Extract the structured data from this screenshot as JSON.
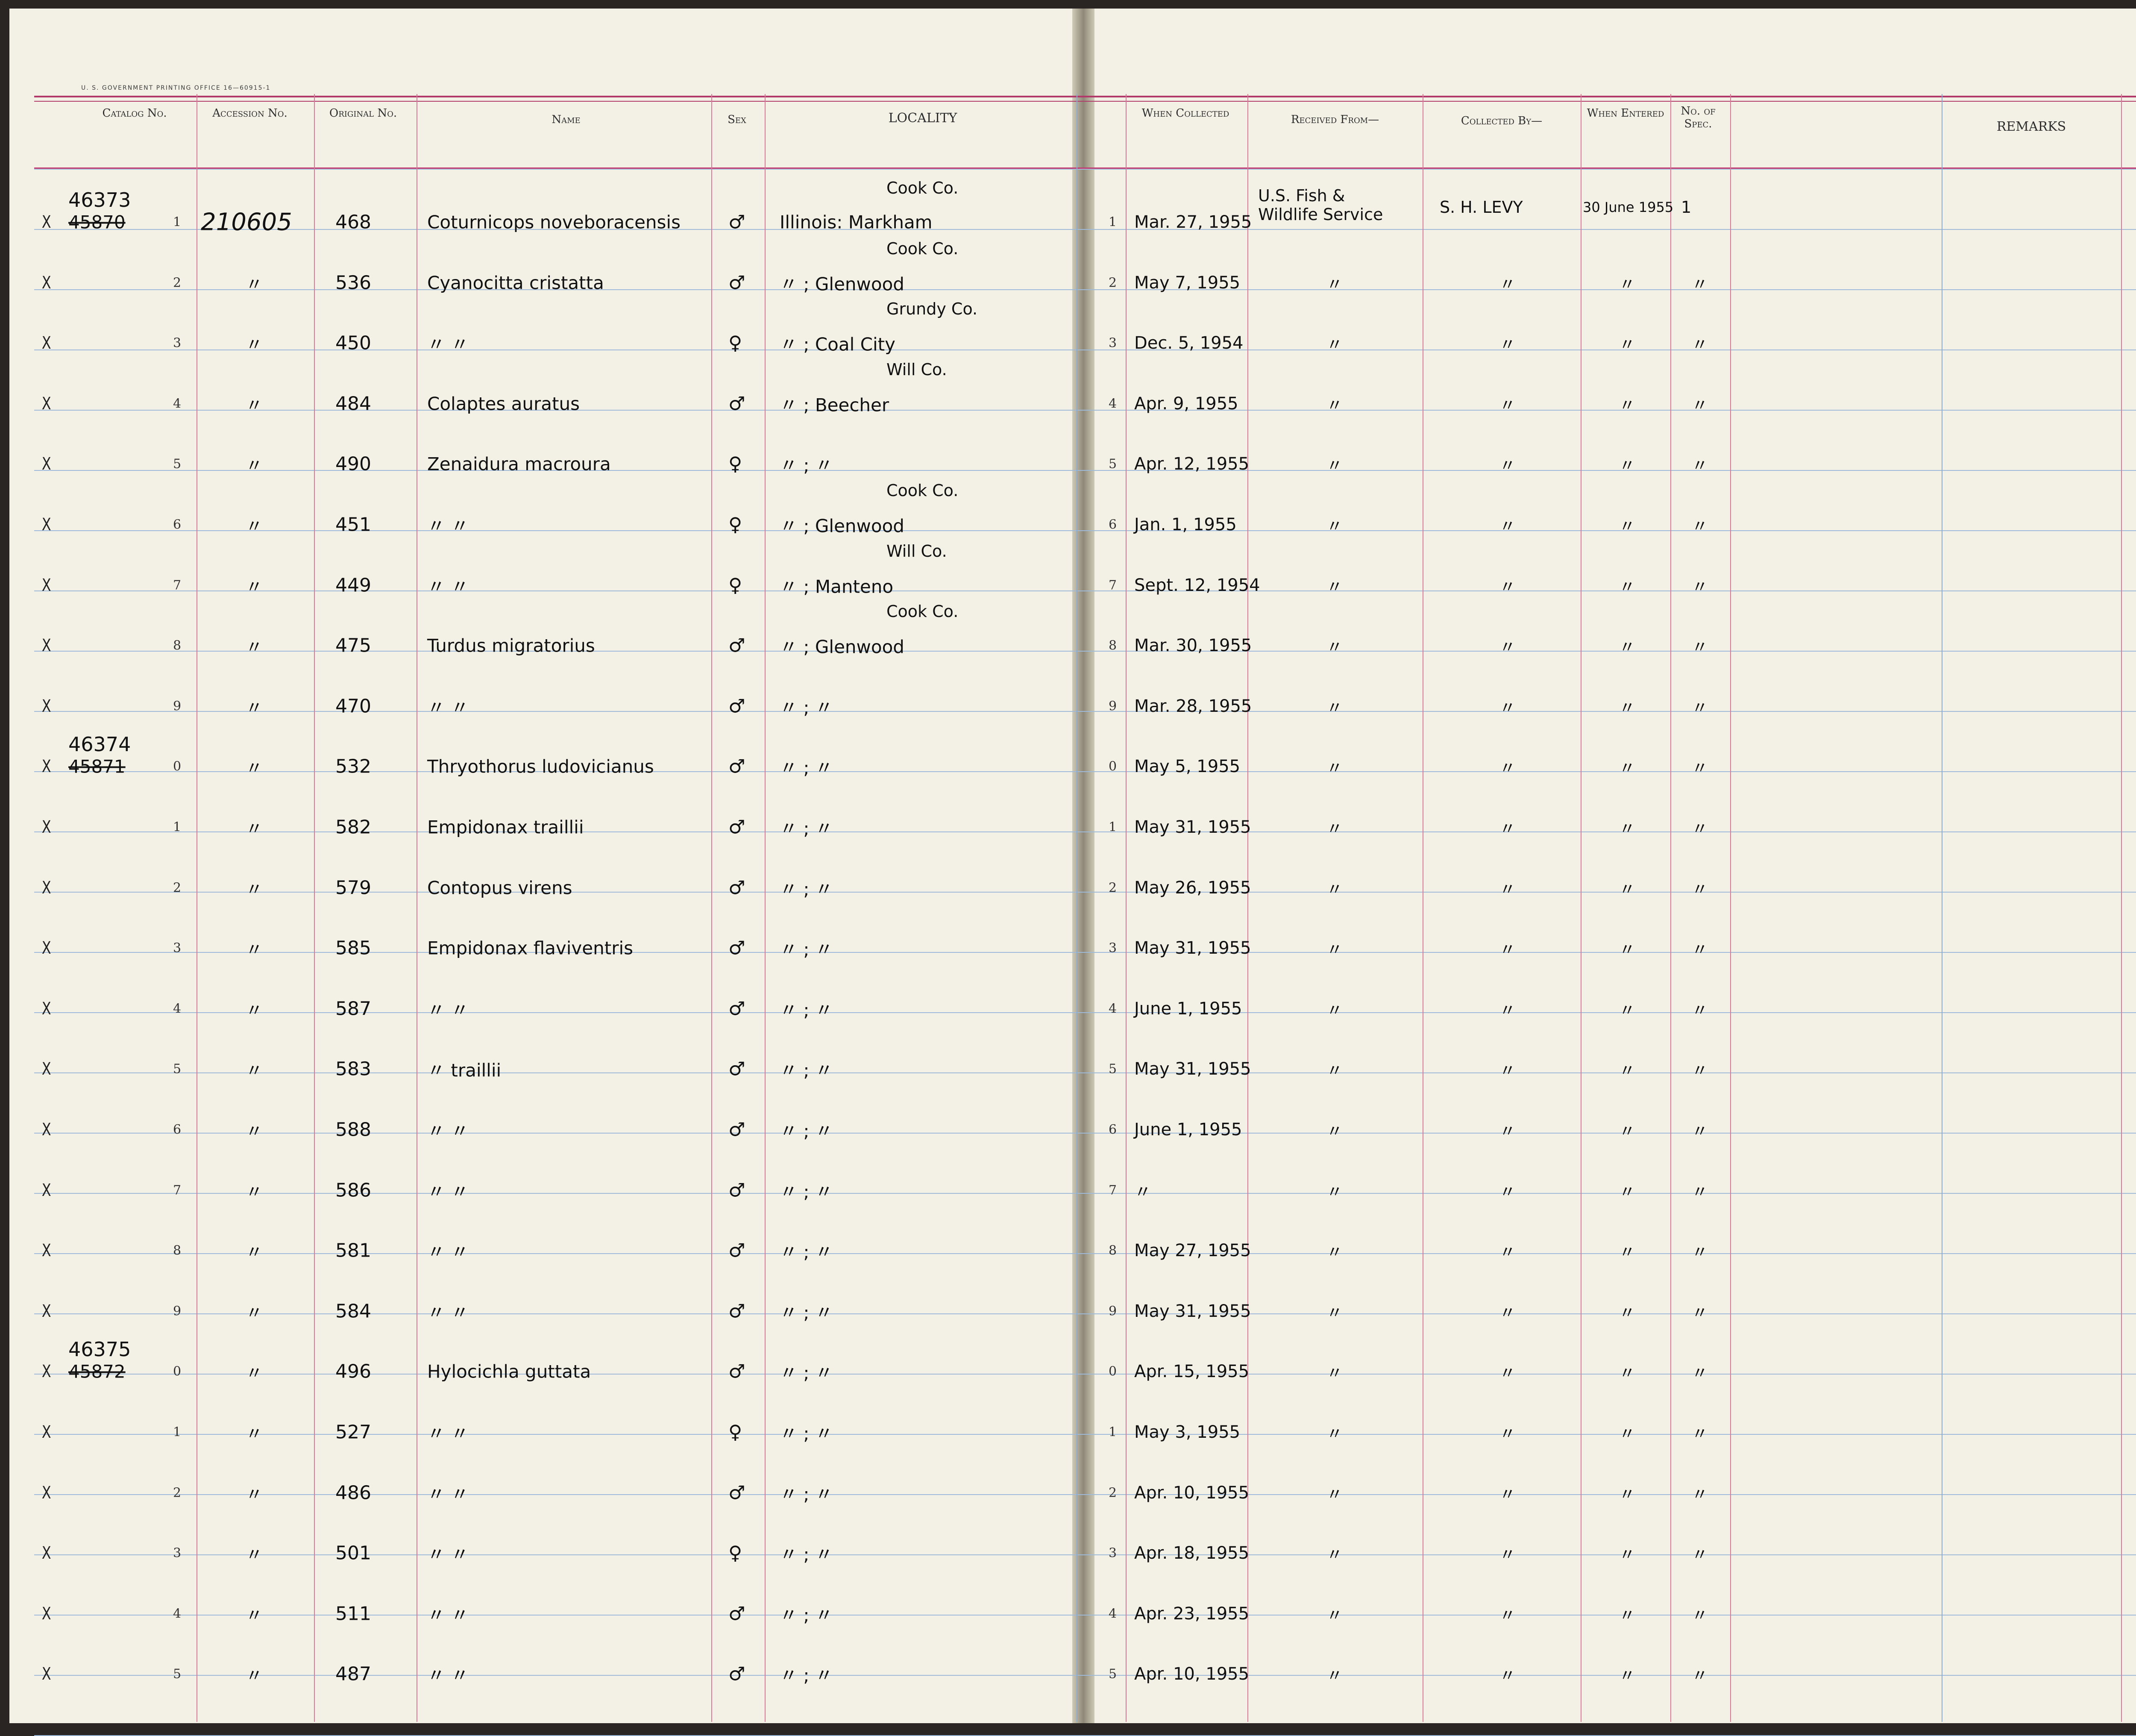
{
  "printer_line": "U. S. GOVERNMENT PRINTING OFFICE     16—60915-1",
  "headers": {
    "catalog": "Catalog No.",
    "accession": "Accession No.",
    "original": "Original No.",
    "name": "Name",
    "sex": "Sex",
    "locality": "LOCALITY",
    "when_collected": "When Collected",
    "received_from": "Received From—",
    "collected_by": "Collected By—",
    "when_entered": "When Entered",
    "no_spec": "No. of Spec.",
    "remarks": "REMARKS"
  },
  "block_labels": [
    {
      "new": "46373",
      "old": "45870"
    },
    {
      "new": "46374",
      "old": "45871"
    },
    {
      "new": "46375",
      "old": "45872"
    }
  ],
  "rows": [
    {
      "check": "X",
      "line": "1",
      "accession": "210605",
      "orig": "468",
      "name": "Coturnicops noveboracensis",
      "sex": "♂",
      "loc_top": "Cook Co.",
      "loc": "Illinois:  Markham",
      "rline": "1",
      "date": "Mar. 27, 1955",
      "recv": "U.S. Fish & Wildlife Service",
      "coll": "S. H. LEVY",
      "entered": "30 June 1955",
      "nspec": "1"
    },
    {
      "check": "X",
      "line": "2",
      "accession": "〃",
      "orig": "536",
      "name": "Cyanocitta  cristatta",
      "sex": "♂",
      "loc_top": "Cook Co.",
      "loc": "〃  ;  Glenwood",
      "rline": "2",
      "date": "May 7, 1955",
      "recv": "〃",
      "coll": "〃",
      "entered": "〃",
      "nspec": "〃"
    },
    {
      "check": "X",
      "line": "3",
      "accession": "〃",
      "orig": "450",
      "name": "〃        〃",
      "sex": "♀",
      "loc_top": "Grundy Co.",
      "loc": "〃  ;  Coal City",
      "rline": "3",
      "date": "Dec. 5, 1954",
      "recv": "〃",
      "coll": "〃",
      "entered": "〃",
      "nspec": "〃"
    },
    {
      "check": "X",
      "line": "4",
      "accession": "〃",
      "orig": "484",
      "name": "Colaptes  auratus",
      "sex": "♂",
      "loc_top": "Will Co.",
      "loc": "〃  ;  Beecher",
      "rline": "4",
      "date": "Apr. 9, 1955",
      "recv": "〃",
      "coll": "〃",
      "entered": "〃",
      "nspec": "〃"
    },
    {
      "check": "X",
      "line": "5",
      "accession": "〃",
      "orig": "490",
      "name": "Zenaidura  macroura",
      "sex": "♀",
      "loc_top": "",
      "loc": "〃  ;     〃",
      "rline": "5",
      "date": "Apr. 12, 1955",
      "recv": "〃",
      "coll": "〃",
      "entered": "〃",
      "nspec": "〃"
    },
    {
      "check": "X",
      "line": "6",
      "accession": "〃",
      "orig": "451",
      "name": "〃        〃",
      "sex": "♀",
      "loc_top": "Cook Co.",
      "loc": "〃  ;  Glenwood",
      "rline": "6",
      "date": "Jan. 1, 1955",
      "recv": "〃",
      "coll": "〃",
      "entered": "〃",
      "nspec": "〃"
    },
    {
      "check": "X",
      "line": "7",
      "accession": "〃",
      "orig": "449",
      "name": "〃        〃",
      "sex": "♀",
      "loc_top": "Will Co.",
      "loc": "〃  ;  Manteno",
      "rline": "7",
      "date": "Sept. 12, 1954",
      "recv": "〃",
      "coll": "〃",
      "entered": "〃",
      "nspec": "〃"
    },
    {
      "check": "X",
      "line": "8",
      "accession": "〃",
      "orig": "475",
      "name": "Turdus  migratorius",
      "sex": "♂",
      "loc_top": "Cook Co.",
      "loc": "〃  ;  Glenwood",
      "rline": "8",
      "date": "Mar. 30, 1955",
      "recv": "〃",
      "coll": "〃",
      "entered": "〃",
      "nspec": "〃"
    },
    {
      "check": "X",
      "line": "9",
      "accession": "〃",
      "orig": "470",
      "name": "〃        〃",
      "sex": "♂",
      "loc_top": "",
      "loc": "〃  ;     〃",
      "rline": "9",
      "date": "Mar. 28, 1955",
      "recv": "〃",
      "coll": "〃",
      "entered": "〃",
      "nspec": "〃"
    },
    {
      "check": "X",
      "line": "0",
      "accession": "〃",
      "orig": "532",
      "name": "Thryothorus  ludovicianus",
      "sex": "♂",
      "loc_top": "",
      "loc": "〃  ;     〃",
      "rline": "0",
      "date": "May 5, 1955",
      "recv": "〃",
      "coll": "〃",
      "entered": "〃",
      "nspec": "〃"
    },
    {
      "check": "X",
      "line": "1",
      "accession": "〃",
      "orig": "582",
      "name": "Empidonax  traillii",
      "sex": "♂",
      "loc_top": "",
      "loc": "〃  ;     〃",
      "rline": "1",
      "date": "May 31, 1955",
      "recv": "〃",
      "coll": "〃",
      "entered": "〃",
      "nspec": "〃"
    },
    {
      "check": "X",
      "line": "2",
      "accession": "〃",
      "orig": "579",
      "name": "Contopus  virens",
      "sex": "♂",
      "loc_top": "",
      "loc": "〃  ;     〃",
      "rline": "2",
      "date": "May 26, 1955",
      "recv": "〃",
      "coll": "〃",
      "entered": "〃",
      "nspec": "〃"
    },
    {
      "check": "X",
      "line": "3",
      "accession": "〃",
      "orig": "585",
      "name": "Empidonax  flaviventris",
      "sex": "♂",
      "loc_top": "",
      "loc": "〃  ;     〃",
      "rline": "3",
      "date": "May 31, 1955",
      "recv": "〃",
      "coll": "〃",
      "entered": "〃",
      "nspec": "〃"
    },
    {
      "check": "X",
      "line": "4",
      "accession": "〃",
      "orig": "587",
      "name": "〃        〃",
      "sex": "♂",
      "loc_top": "",
      "loc": "〃  ;     〃",
      "rline": "4",
      "date": "June 1, 1955",
      "recv": "〃",
      "coll": "〃",
      "entered": "〃",
      "nspec": "〃"
    },
    {
      "check": "X",
      "line": "5",
      "accession": "〃",
      "orig": "583",
      "name": "〃   traillii",
      "sex": "♂",
      "loc_top": "",
      "loc": "〃  ;     〃",
      "rline": "5",
      "date": "May 31, 1955",
      "recv": "〃",
      "coll": "〃",
      "entered": "〃",
      "nspec": "〃"
    },
    {
      "check": "X",
      "line": "6",
      "accession": "〃",
      "orig": "588",
      "name": "〃    〃",
      "sex": "♂",
      "loc_top": "",
      "loc": "〃  ;     〃",
      "rline": "6",
      "date": "June 1, 1955",
      "recv": "〃",
      "coll": "〃",
      "entered": "〃",
      "nspec": "〃"
    },
    {
      "check": "X",
      "line": "7",
      "accession": "〃",
      "orig": "586",
      "name": "〃    〃",
      "sex": "♂",
      "loc_top": "",
      "loc": "〃  ;     〃",
      "rline": "7",
      "date": "〃",
      "recv": "〃",
      "coll": "〃",
      "entered": "〃",
      "nspec": "〃"
    },
    {
      "check": "X",
      "line": "8",
      "accession": "〃",
      "orig": "581",
      "name": "〃    〃",
      "sex": "♂",
      "loc_top": "",
      "loc": "〃  ;     〃",
      "rline": "8",
      "date": "May 27, 1955",
      "recv": "〃",
      "coll": "〃",
      "entered": "〃",
      "nspec": "〃"
    },
    {
      "check": "X",
      "line": "9",
      "accession": "〃",
      "orig": "584",
      "name": "〃    〃",
      "sex": "♂",
      "loc_top": "",
      "loc": "〃  ;     〃",
      "rline": "9",
      "date": "May 31, 1955",
      "recv": "〃",
      "coll": "〃",
      "entered": "〃",
      "nspec": "〃"
    },
    {
      "check": "X",
      "line": "0",
      "accession": "〃",
      "orig": "496",
      "name": "Hylocichla  guttata",
      "sex": "♂",
      "loc_top": "",
      "loc": "〃  ;     〃",
      "rline": "0",
      "date": "Apr. 15, 1955",
      "recv": "〃",
      "coll": "〃",
      "entered": "〃",
      "nspec": "〃"
    },
    {
      "check": "X",
      "line": "1",
      "accession": "〃",
      "orig": "527",
      "name": "〃        〃",
      "sex": "♀",
      "loc_top": "",
      "loc": "〃  ;     〃",
      "rline": "1",
      "date": "May 3, 1955",
      "recv": "〃",
      "coll": "〃",
      "entered": "〃",
      "nspec": "〃"
    },
    {
      "check": "X",
      "line": "2",
      "accession": "〃",
      "orig": "486",
      "name": "〃        〃",
      "sex": "♂",
      "loc_top": "",
      "loc": "〃  ;     〃",
      "rline": "2",
      "date": "Apr. 10, 1955",
      "recv": "〃",
      "coll": "〃",
      "entered": "〃",
      "nspec": "〃"
    },
    {
      "check": "X",
      "line": "3",
      "accession": "〃",
      "orig": "501",
      "name": "〃        〃",
      "sex": "♀",
      "loc_top": "",
      "loc": "〃  ;     〃",
      "rline": "3",
      "date": "Apr. 18, 1955",
      "recv": "〃",
      "coll": "〃",
      "entered": "〃",
      "nspec": "〃"
    },
    {
      "check": "X",
      "line": "4",
      "accession": "〃",
      "orig": "511",
      "name": "〃        〃",
      "sex": "♂",
      "loc_top": "",
      "loc": "〃  ;     〃",
      "rline": "4",
      "date": "Apr. 23, 1955",
      "recv": "〃",
      "coll": "〃",
      "entered": "〃",
      "nspec": "〃"
    },
    {
      "check": "X",
      "line": "5",
      "accession": "〃",
      "orig": "487",
      "name": "〃        〃",
      "sex": "♂",
      "loc_top": "",
      "loc": "〃  ;     〃",
      "rline": "5",
      "date": "Apr. 10, 1955",
      "recv": "〃",
      "coll": "〃",
      "entered": "〃",
      "nspec": "〃"
    }
  ]
}
